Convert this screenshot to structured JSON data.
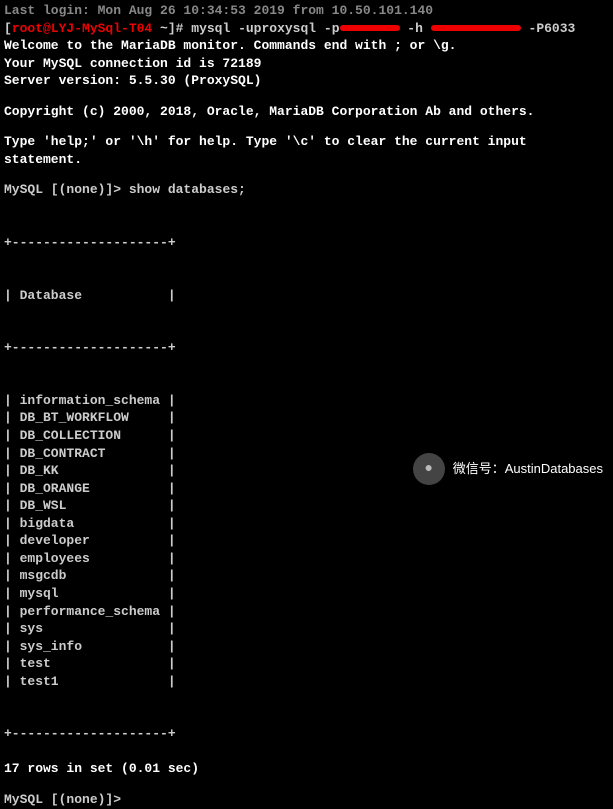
{
  "last_login": "Last login: Mon Aug 26 10:34:53 2019 from 10.50.101.140",
  "prompt": {
    "open": "[",
    "userhost": "root@LYJ-MySql-T04",
    "path": " ~",
    "close": "]# ",
    "cmd_part1": "mysql -uproxysql -p",
    "cmd_part2": " -h ",
    "cmd_part3": " -P6033"
  },
  "welcome": {
    "l1": "Welcome to the MariaDB monitor.  Commands end with ; or \\g.",
    "l2": "Your MySQL connection id is 72189",
    "l3": "Server version: 5.5.30 (ProxySQL)"
  },
  "copyright": "Copyright (c) 2000, 2018, Oracle, MariaDB Corporation Ab and others.",
  "help": "Type 'help;' or '\\h' for help. Type '\\c' to clear the current input statement.",
  "mysql_prompt": "MySQL [(none)]> ",
  "command": "show databases;",
  "table": {
    "border": "+--------------------+",
    "header": "| Database           |",
    "rows": [
      "| information_schema |",
      "| DB_BT_WORKFLOW     |",
      "| DB_COLLECTION      |",
      "| DB_CONTRACT        |",
      "| DB_KK              |",
      "| DB_ORANGE          |",
      "| DB_WSL             |",
      "| bigdata            |",
      "| developer          |",
      "| employees          |",
      "| msgcdb             |",
      "| mysql              |",
      "| performance_schema |",
      "| sys                |",
      "| sys_info           |",
      "| test               |",
      "| test1              |"
    ]
  },
  "result": "17 rows in set (0.01 sec)",
  "cursor_prompt": "MySQL [(none)]> ",
  "watermark": {
    "label": "微信号：",
    "value": "AustinDatabases",
    "icon": "●"
  }
}
